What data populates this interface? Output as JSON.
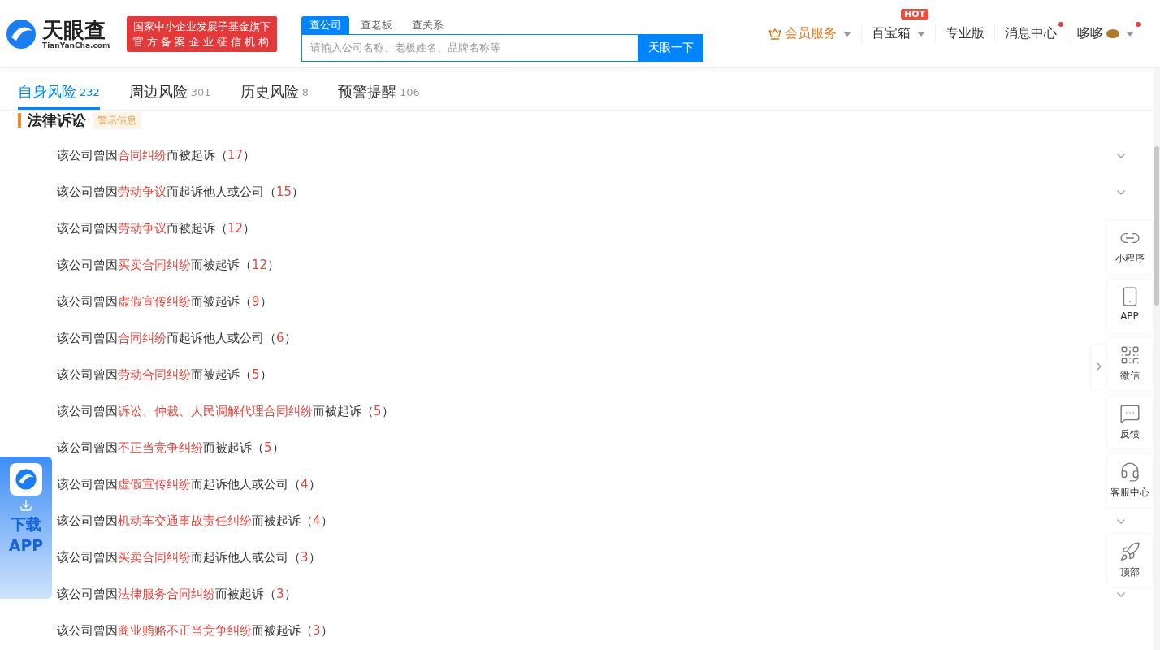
{
  "header": {
    "logo": {
      "name": "天眼查",
      "domain": "TianYanCha.com"
    },
    "slogan": [
      "国家中小企业发展子基金旗下",
      "官 方 备 案 企 业 征 信 机 构"
    ],
    "search": {
      "tabs": [
        {
          "label": "查公司",
          "selected": true
        },
        {
          "label": "查老板",
          "selected": false
        },
        {
          "label": "查关系",
          "selected": false
        }
      ],
      "placeholder": "请输入公司名称、老板姓名、品牌名称等",
      "button": "天眼一下"
    },
    "nav": [
      {
        "kind": "vip",
        "label": "会员服务",
        "dropdown": true,
        "dot": false
      },
      {
        "kind": "plain",
        "label": "百宝箱",
        "dropdown": true,
        "dot": false,
        "badge": "HOT"
      },
      {
        "kind": "plain",
        "label": "专业版",
        "dropdown": false,
        "dot": false
      },
      {
        "kind": "plain",
        "label": "消息中心",
        "dropdown": false,
        "dot": true
      },
      {
        "kind": "user",
        "label": "哆哆",
        "dropdown": true,
        "dot": true
      }
    ]
  },
  "risk_tabs": [
    {
      "label": "自身风险",
      "count": "232",
      "selected": true
    },
    {
      "label": "周边风险",
      "count": "301",
      "selected": false
    },
    {
      "label": "历史风险",
      "count": "8",
      "selected": false
    },
    {
      "label": "预警提醒",
      "count": "106",
      "selected": false
    }
  ],
  "section": {
    "title": "法律诉讼",
    "tag": "警示信息"
  },
  "rows": [
    {
      "before": "该公司曾因",
      "cause": "合同纠纷",
      "after": "而被起诉（",
      "count": "17",
      "close": "）",
      "expandable": true
    },
    {
      "before": "该公司曾因",
      "cause": "劳动争议",
      "after": "而起诉他人或公司（",
      "count": "15",
      "close": "）",
      "expandable": true
    },
    {
      "before": "该公司曾因",
      "cause": "劳动争议",
      "after": "而被起诉（",
      "count": "12",
      "close": "）",
      "expandable": false
    },
    {
      "before": "该公司曾因",
      "cause": "买卖合同纠纷",
      "after": "而被起诉（",
      "count": "12",
      "close": "）",
      "expandable": false
    },
    {
      "before": "该公司曾因",
      "cause": "虚假宣传纠纷",
      "after": "而被起诉（",
      "count": "9",
      "close": "）",
      "expandable": false
    },
    {
      "before": "该公司曾因",
      "cause": "合同纠纷",
      "after": "而起诉他人或公司（",
      "count": "6",
      "close": "）",
      "expandable": false
    },
    {
      "before": "该公司曾因",
      "cause": "劳动合同纠纷",
      "after": "而被起诉（",
      "count": "5",
      "close": "）",
      "expandable": false
    },
    {
      "before": "该公司曾因",
      "cause": "诉讼、仲裁、人民调解代理合同纠纷",
      "after": "而被起诉（",
      "count": "5",
      "close": "）",
      "expandable": false
    },
    {
      "before": "该公司曾因",
      "cause": "不正当竞争纠纷",
      "after": "而被起诉（",
      "count": "5",
      "close": "）",
      "expandable": false
    },
    {
      "before": "该公司曾因",
      "cause": "虚假宣传纠纷",
      "after": "而起诉他人或公司（",
      "count": "4",
      "close": "）",
      "expandable": false
    },
    {
      "before": "该公司曾因",
      "cause": "机动车交通事故责任纠纷",
      "after": "而被起诉（",
      "count": "4",
      "close": "）",
      "expandable": true
    },
    {
      "before": "该公司曾因",
      "cause": "买卖合同纠纷",
      "after": "而起诉他人或公司（",
      "count": "3",
      "close": "）",
      "expandable": false
    },
    {
      "before": "该公司曾因",
      "cause": "法律服务合同纠纷",
      "after": "而被起诉（",
      "count": "3",
      "close": "）",
      "expandable": true
    },
    {
      "before": "该公司曾因",
      "cause": "商业贿赂不正当竞争纠纷",
      "after": "而被起诉（",
      "count": "3",
      "close": "）",
      "expandable": false
    }
  ],
  "side_panel": [
    {
      "kind": "miniprogram",
      "label": "小程序"
    },
    {
      "kind": "phone",
      "label": "APP"
    },
    {
      "kind": "qr",
      "label": "微信"
    },
    {
      "kind": "chat",
      "label": "反馈"
    },
    {
      "kind": "service",
      "label": "客服中心"
    },
    {
      "kind": "rocket",
      "label": "顶部"
    }
  ],
  "download_banner": {
    "lines": [
      "下载",
      "APP"
    ]
  }
}
